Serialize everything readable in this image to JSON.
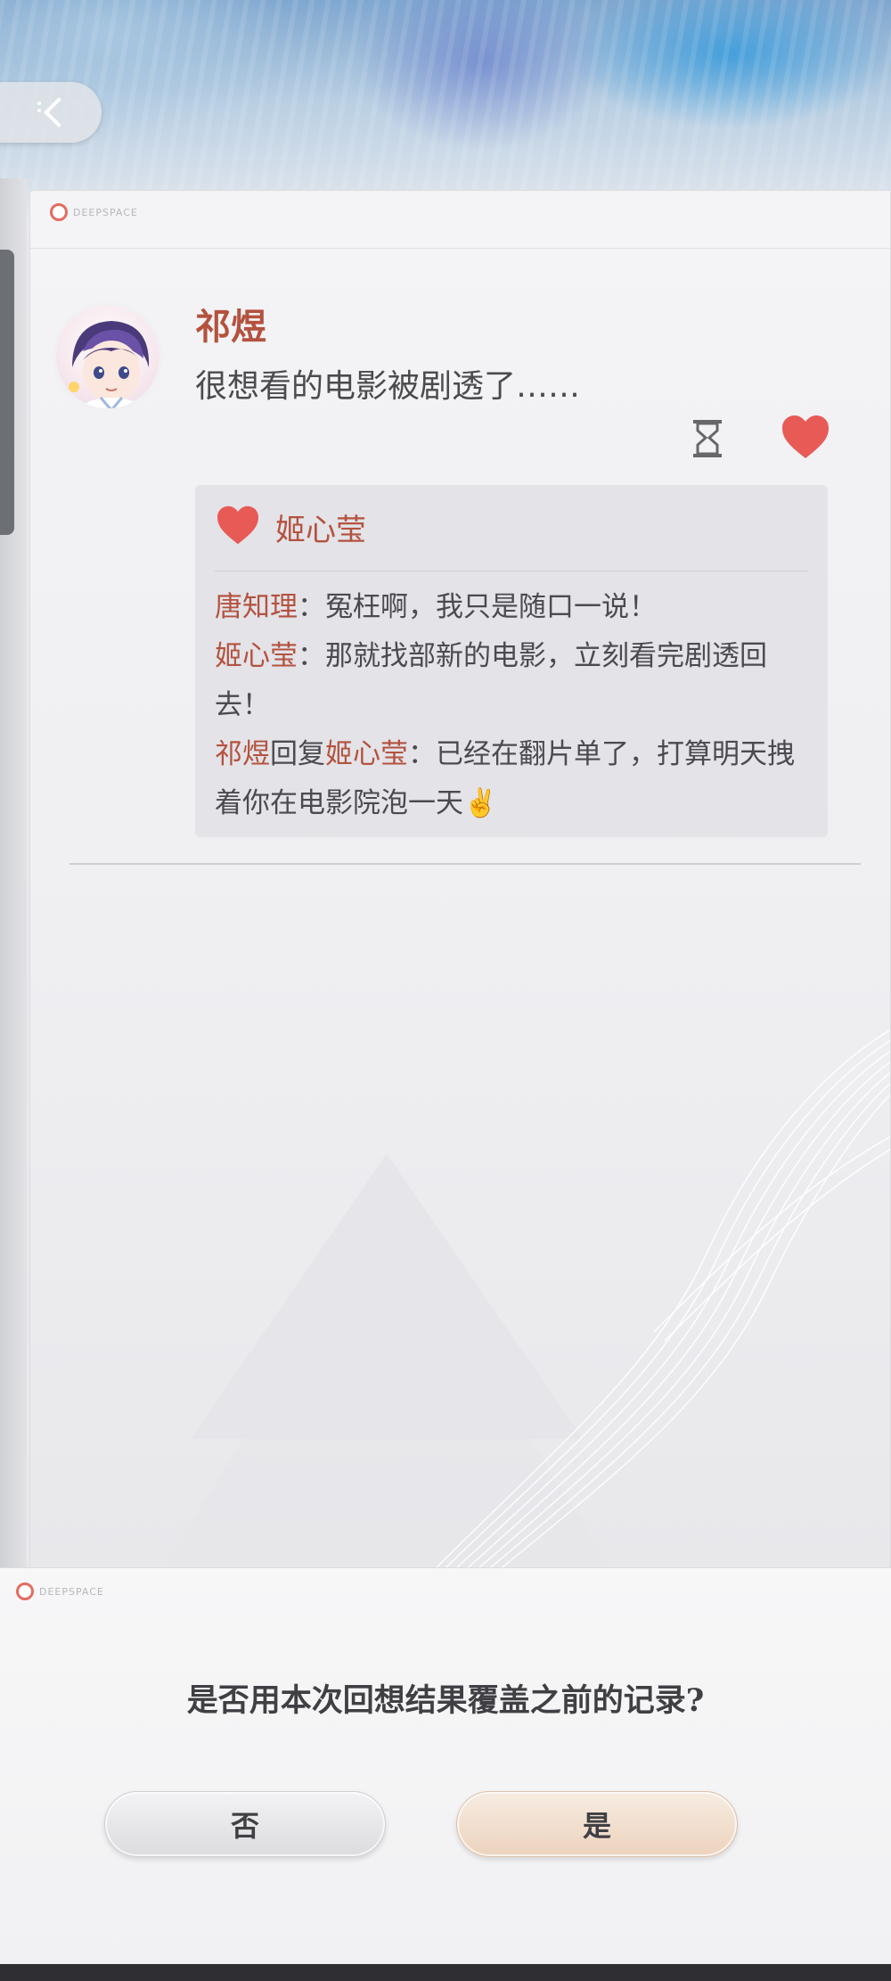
{
  "header": {
    "back_icon": "chevron-left-icon"
  },
  "card": {
    "brand": "DEEPSPACE",
    "post": {
      "author": "祁煜",
      "text": "很想看的电影被剧透了……",
      "liked": true
    },
    "likes": {
      "names": "姬心莹"
    },
    "comments": [
      {
        "who": "唐知理",
        "sep": "：",
        "text": "冤枉啊，我只是随口一说！"
      },
      {
        "who": "姬心莹",
        "sep": "：",
        "text": "那就找部新的电影，立刻看完剧透回去！"
      },
      {
        "who": "祁煜",
        "reply": "回复",
        "to": "姬心莹",
        "sep": "：",
        "text": "已经在翻片单了，打算明天拽着你在电影院泡一天✌️"
      }
    ]
  },
  "dialog": {
    "brand": "DEEPSPACE",
    "question": "是否用本次回想结果覆盖之前的记录?",
    "no_label": "否",
    "yes_label": "是"
  },
  "colors": {
    "accent": "#b4523e",
    "heart": "#e85a55"
  }
}
